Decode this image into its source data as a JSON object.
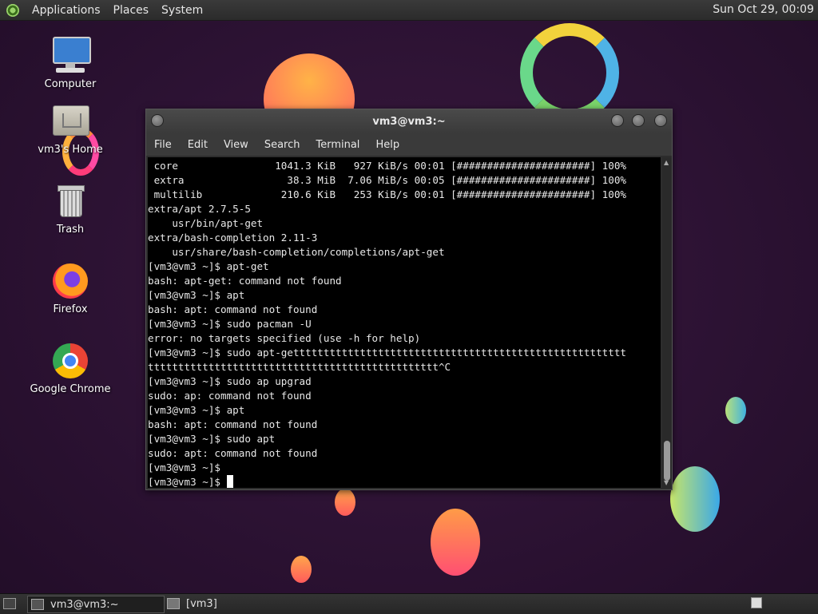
{
  "top_panel": {
    "menus": [
      "Applications",
      "Places",
      "System"
    ],
    "clock": "Sun Oct 29, 00:09"
  },
  "desktop": {
    "icons": [
      {
        "label": "Computer",
        "icon": "computer-icon"
      },
      {
        "label": "vm3's Home",
        "icon": "home-folder-icon"
      },
      {
        "label": "Trash",
        "icon": "trash-icon"
      },
      {
        "label": "Firefox",
        "icon": "firefox-icon"
      },
      {
        "label": "Google Chrome",
        "icon": "chrome-icon"
      }
    ]
  },
  "terminal": {
    "title": "vm3@vm3:~",
    "menu": [
      "File",
      "Edit",
      "View",
      "Search",
      "Terminal",
      "Help"
    ],
    "lines": [
      " core                1041.3 KiB   927 KiB/s 00:01 [######################] 100%",
      " extra                 38.3 MiB  7.06 MiB/s 00:05 [######################] 100%",
      " multilib             210.6 KiB   253 KiB/s 00:01 [######################] 100%",
      "extra/apt 2.7.5-5",
      "    usr/bin/apt-get",
      "extra/bash-completion 2.11-3",
      "    usr/share/bash-completion/completions/apt-get",
      "[vm3@vm3 ~]$ apt-get",
      "bash: apt-get: command not found",
      "[vm3@vm3 ~]$ apt",
      "bash: apt: command not found",
      "[vm3@vm3 ~]$ sudo pacman -U",
      "error: no targets specified (use -h for help)",
      "[vm3@vm3 ~]$ sudo apt-gettttttttttttttttttttttttttttttttttttttttttttttttttttttt",
      "tttttttttttttttttttttttttttttttttttttttttttttttt^C",
      "[vm3@vm3 ~]$ sudo ap upgrad",
      "sudo: ap: command not found",
      "[vm3@vm3 ~]$ apt",
      "bash: apt: command not found",
      "[vm3@vm3 ~]$ sudo apt",
      "sudo: apt: command not found",
      "[vm3@vm3 ~]$"
    ],
    "prompt": "[vm3@vm3 ~]$ "
  },
  "taskbar": {
    "tasks": [
      "vm3@vm3:~",
      "[vm3]"
    ]
  }
}
